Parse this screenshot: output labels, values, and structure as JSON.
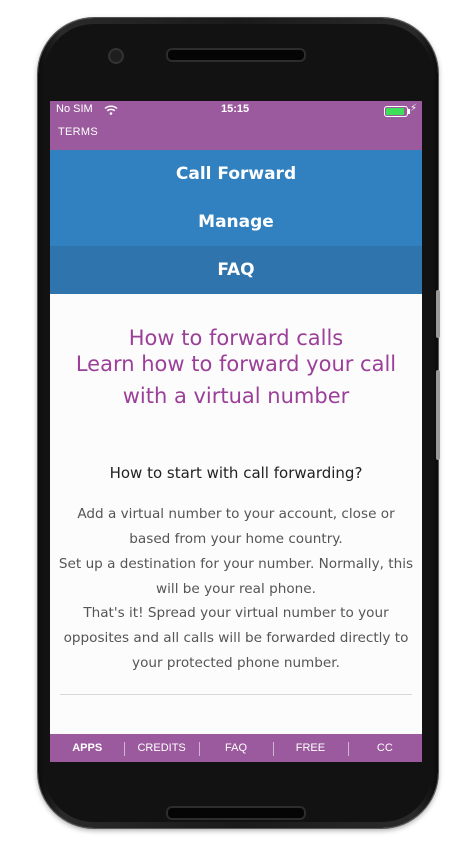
{
  "status": {
    "carrier": "No SIM",
    "time": "15:15",
    "battery": 1.0
  },
  "topbar": {
    "terms_label": "TERMS"
  },
  "menu": {
    "call_forward": "Call Forward",
    "manage": "Manage",
    "faq": "FAQ"
  },
  "content": {
    "title_line1": "How to forward calls",
    "title_line2": "Learn how to forward your call",
    "title_line3": "with a virtual number",
    "subheading": "How to start with call forwarding?",
    "step1": "Add a virtual number to your account, close or based from your home country.",
    "step2": "Set up a destination for your number. Normally, this will be your real phone.",
    "step3": "That's it! Spread your virtual number to your opposites and all calls will be forwarded directly to your protected phone number."
  },
  "tabs": [
    "APPS",
    "CREDITS",
    "FAQ",
    "FREE",
    "CC"
  ],
  "colors": {
    "status_bar": "#9b5a9e",
    "menu_blue": "#3180bf",
    "menu_active": "#2f74ad",
    "heading_purple": "#9b3f98",
    "battery_green": "#3ee05a"
  }
}
